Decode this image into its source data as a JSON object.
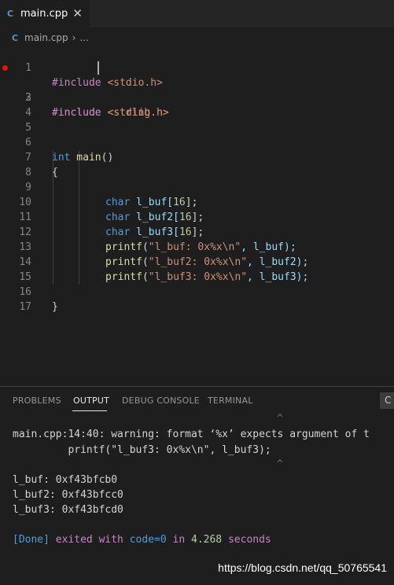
{
  "tab": {
    "icon": "C",
    "title": "main.cpp",
    "close": "✕"
  },
  "breadcrumb": {
    "icon": "C",
    "file": "main.cpp",
    "sep": "›",
    "more": "..."
  },
  "editor": {
    "line_numbers": [
      "1",
      "2",
      "3",
      "4",
      "5",
      "6",
      "7",
      "8",
      "9",
      "10",
      "11",
      "12",
      "13",
      "14",
      "15",
      "16",
      "17"
    ],
    "breakpoint_line": 2,
    "l1": {
      "kw": "#include",
      "inc": " <stdio.h>"
    },
    "l2": {
      "kw": "#include",
      "inc": " <string.h>"
    },
    "l3": {
      "kw": "#include",
      "inc": " <stdlib.h>"
    },
    "l6": {
      "ty": "int",
      "fn": " main",
      "rest": "()"
    },
    "l7": "{",
    "l9": {
      "ty": "char",
      "rest": " l_buf[",
      "num": "16",
      "end": "];"
    },
    "l10": {
      "ty": "char",
      "rest": " l_buf2[",
      "num": "16",
      "end": "];"
    },
    "l11": {
      "ty": "char",
      "rest": " l_buf3[",
      "num": "16",
      "end": "];"
    },
    "l12": {
      "fn": "printf",
      "open": "(",
      "str": "\"l_buf: 0x%x\\n\"",
      "rest": ", l_buf);"
    },
    "l13": {
      "fn": "printf",
      "open": "(",
      "str": "\"l_buf2: 0x%x\\n\"",
      "rest": ", l_buf2);"
    },
    "l14": {
      "fn": "printf",
      "open": "(",
      "str": "\"l_buf3: 0x%x\\n\"",
      "rest": ", l_buf3);"
    },
    "l16": "}"
  },
  "panel": {
    "tabs": [
      "PROBLEMS",
      "OUTPUT",
      "DEBUG CONSOLE",
      "TERMINAL"
    ],
    "active_tab": "OUTPUT",
    "action_label": "C",
    "output": {
      "caret1": "^",
      "warning": "main.cpp:14:40: warning: format ‘%x’ expects argument of t",
      "warning_code": "         printf(\"l_buf3: 0x%x\\n\", l_buf3);",
      "caret2": "^",
      "results": [
        "l_buf: 0xf43bfcb0",
        "l_buf2: 0xf43bfcc0",
        "l_buf3: 0xf43bfcd0"
      ],
      "done": {
        "tag": "[Done]",
        "exited": " exited with ",
        "code": "code=0",
        "in": " in ",
        "time": "4.268",
        "seconds": " seconds"
      }
    }
  },
  "watermark": "https://blog.csdn.net/qq_50765541",
  "colors": {
    "background": "#1e1e1e",
    "keyword": "#c586c0",
    "type": "#569cd6",
    "function": "#dcdcaa",
    "string": "#ce9178",
    "number": "#b5cea8",
    "breakpoint": "#e51400"
  }
}
